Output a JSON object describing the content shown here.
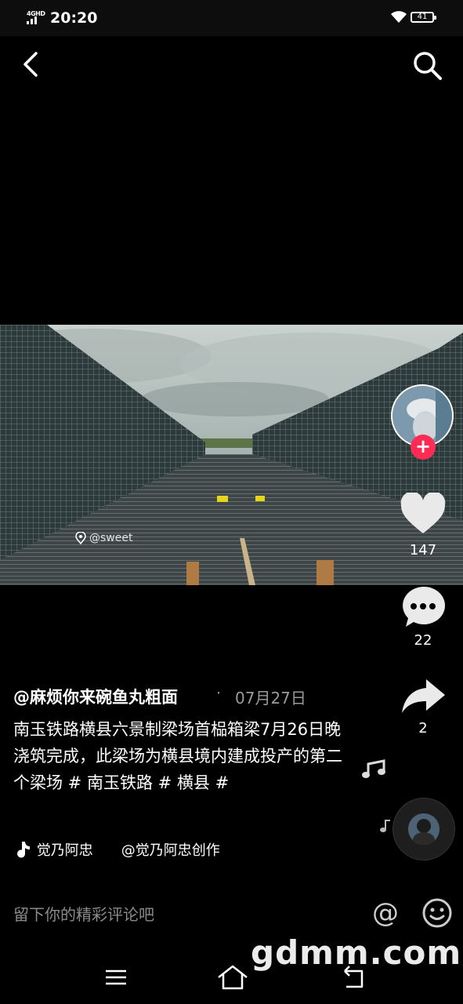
{
  "status_bar": {
    "network": "4GHD",
    "time": "20:20",
    "battery": "41"
  },
  "video": {
    "location_tag": "@sweet"
  },
  "sidebar": {
    "likes": "147",
    "comments": "22",
    "shares": "2"
  },
  "post": {
    "author": "@麻烦你来碗鱼丸粗面",
    "separator": "·",
    "date": "07月27日",
    "description": "南玉铁路横县六景制梁场首榀箱梁7月26日晚浇筑完成，此梁场为横县境内建成投产的第二个梁场 # 南玉铁路 # 横县 #",
    "music_text": "觉乃阿忠　　@觉乃阿忠创作"
  },
  "comment": {
    "placeholder": "留下你的精彩评论吧",
    "at_symbol": "@"
  },
  "watermark": "gdmm.com"
}
